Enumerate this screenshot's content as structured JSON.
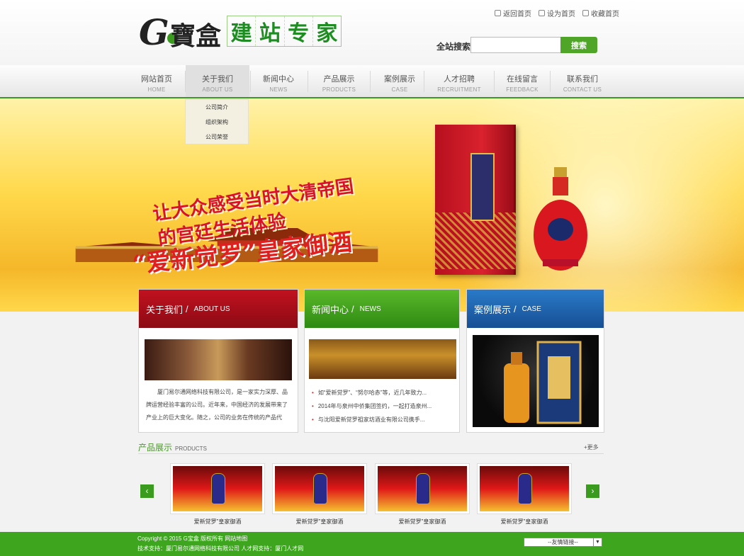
{
  "header": {
    "logo_g": "G",
    "logo_name": "寶盒",
    "slogan": [
      "建",
      "站",
      "专",
      "家"
    ],
    "toplinks": [
      "返回首页",
      "设为首页",
      "收藏首页"
    ],
    "search_label": "全站搜索:",
    "search_placeholder": "",
    "search_button": "搜索"
  },
  "nav": [
    {
      "cn": "网站首页",
      "en": "HOME"
    },
    {
      "cn": "关于我们",
      "en": "ABOUT US"
    },
    {
      "cn": "新闻中心",
      "en": "NEWS"
    },
    {
      "cn": "产品展示",
      "en": "PRODUCTS"
    },
    {
      "cn": "案例展示",
      "en": "CASE"
    },
    {
      "cn": "人才招聘",
      "en": "RECRUITMENT"
    },
    {
      "cn": "在线留言",
      "en": "FEEDBACK"
    },
    {
      "cn": "联系我们",
      "en": "CONTACT US"
    }
  ],
  "submenu": [
    "公司简介",
    "组织架构",
    "公司荣誉"
  ],
  "banner": {
    "title": "“爱新觉罗”皇家御酒",
    "line1": "让大众感受当时大清帝国",
    "line2": "的宫廷生活体验"
  },
  "about": {
    "title": "关于我们",
    "title_en": "ABOUT US",
    "text": "厦门易尔通网络科技有限公司，是一家实力深厚、品牌运营经验丰富的公司。近年来，中国经济的发展带来了产业上的巨大变化。随之，公司的业务在传统的产品代"
  },
  "news": {
    "title": "新闻中心",
    "title_en": "NEWS",
    "items": [
      "如“爱新觉罗”、“努尔哈赤”等，近几年致力...",
      "2014年与泉州中侨集团签约，一起打造泉州...",
      "与沈阳爱新觉罗祖家坊酒业有限公司携手..."
    ]
  },
  "case": {
    "title": "案例展示",
    "title_en": "CASE"
  },
  "products": {
    "title": "产品展示",
    "title_en": "PRODUCTS",
    "more": "+更多",
    "items": [
      "爱新觉罗”皇家御酒",
      "爱新觉罗”皇家御酒",
      "爱新觉罗”皇家御酒",
      "爱新觉罗”皇家御酒"
    ],
    "prev": "‹",
    "next": "›"
  },
  "footer": {
    "line1": "Copyright © 2015 G宝盒 版权所有  网站地图",
    "line2": "技术支持：厦门易尔通网络科技有限公司 人才网支持：厦门人才网",
    "friend_links": "--友情链接--"
  },
  "colors": {
    "green": "#3a9b1f",
    "red_header": "#b30f1c",
    "blue_header": "#1f5fa8"
  }
}
